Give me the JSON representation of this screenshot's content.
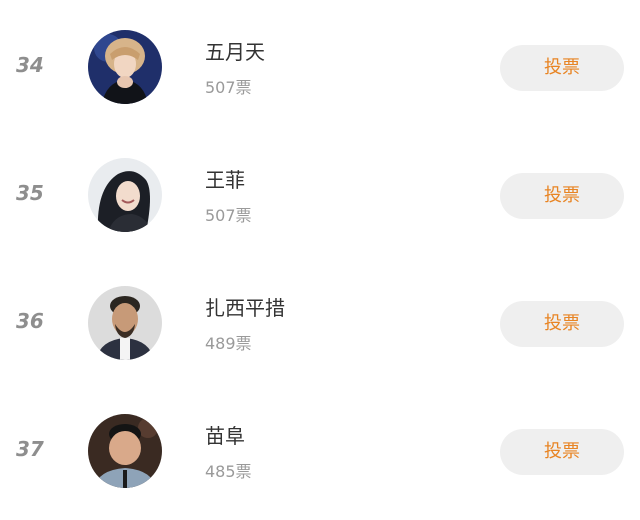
{
  "entries": [
    {
      "rank": "34",
      "name": "五月天",
      "votes": "507票",
      "vote_label": "投票",
      "avatar_icon": "avatar-photo-wuyuetian"
    },
    {
      "rank": "35",
      "name": "王菲",
      "votes": "507票",
      "vote_label": "投票",
      "avatar_icon": "avatar-photo-wangfei"
    },
    {
      "rank": "36",
      "name": "扎西平措",
      "votes": "489票",
      "vote_label": "投票",
      "avatar_icon": "avatar-photo-zhaxipingcuo"
    },
    {
      "rank": "37",
      "name": "苗阜",
      "votes": "485票",
      "vote_label": "投票",
      "avatar_icon": "avatar-photo-miaofu"
    }
  ],
  "colors": {
    "vote_text": "#e88423",
    "vote_bg": "#efefef",
    "rank_text": "#8e8e8e",
    "name_text": "#333333",
    "votes_text": "#9a9a9a"
  }
}
